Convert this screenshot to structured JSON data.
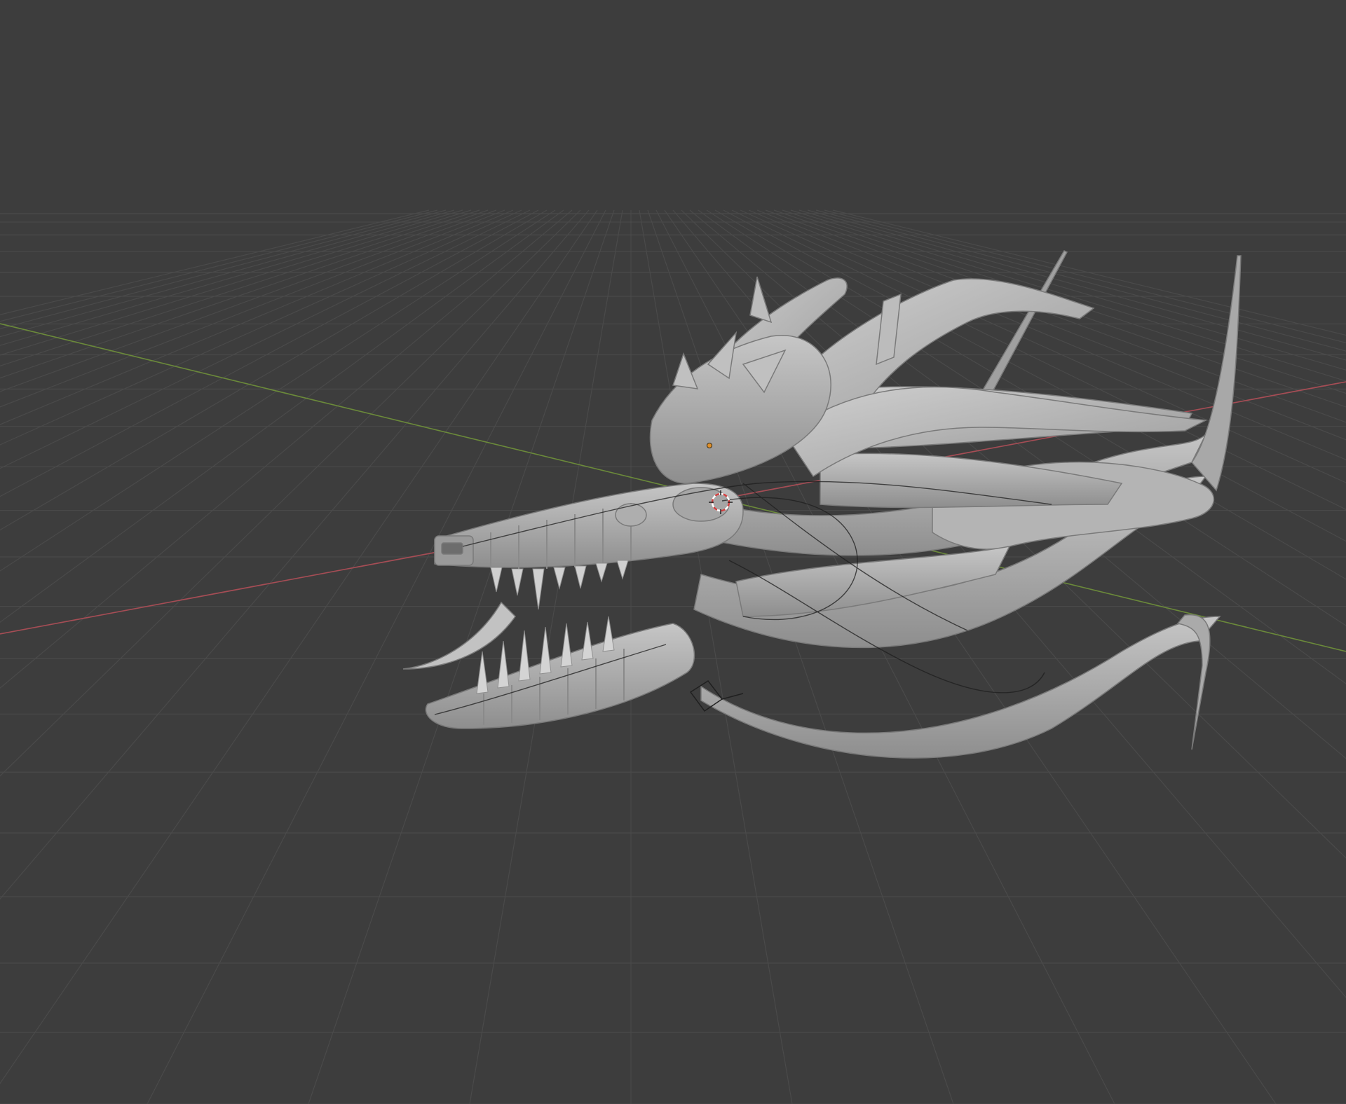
{
  "viewport": {
    "background": "#3d3d3d",
    "grid_color": "#4a4a4a",
    "x_axis_color": "#a64d55",
    "y_axis_color": "#6b8a3a",
    "shading": "solid",
    "model_color": "#b9b9b9"
  },
  "scene": {
    "object": "dragon-head-mesh",
    "object_origin_color": "#e0902a",
    "cursor_colors": [
      "#d04040",
      "#ffffff"
    ],
    "camera_gizmo": "camera-icon",
    "curve_overlay": "bezier-curve-lines"
  }
}
